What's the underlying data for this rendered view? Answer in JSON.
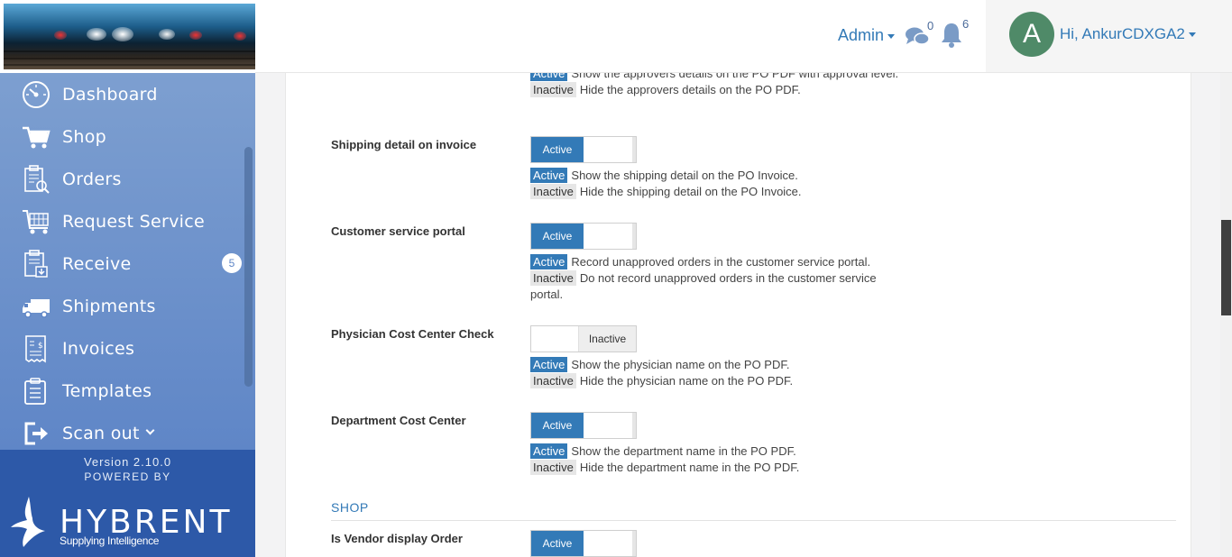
{
  "header": {
    "admin_label": "Admin",
    "messages_count": "0",
    "notifications_count": "6",
    "avatar_initial": "A",
    "user_greeting": "Hi, AnkurCDXGA2"
  },
  "sidebar": {
    "items": [
      {
        "label": "Dashboard",
        "icon": "dashboard-gauge-icon"
      },
      {
        "label": "Shop",
        "icon": "shopping-cart-icon"
      },
      {
        "label": "Orders",
        "icon": "orders-clipboard-search-icon"
      },
      {
        "label": "Request Service",
        "icon": "service-cart-icon"
      },
      {
        "label": "Receive",
        "icon": "receive-clipboard-icon",
        "badge": "5"
      },
      {
        "label": "Shipments",
        "icon": "delivery-truck-icon"
      },
      {
        "label": "Invoices",
        "icon": "invoice-receipt-icon"
      },
      {
        "label": "Templates",
        "icon": "templates-clipboard-icon"
      },
      {
        "label": "Scan out",
        "icon": "scan-out-exit-icon"
      }
    ],
    "version": "Version 2.10.0",
    "powered_by": "POWERED BY",
    "brand_name": "HYBRENT",
    "brand_tagline": "Supplying Intelligence"
  },
  "settings": {
    "partial_top": {
      "active_tag": "Active",
      "active_text": "Show the approvers details on the PO PDF with approval level.",
      "inactive_tag": "Inactive",
      "inactive_text": "Hide the approvers details on the PO PDF."
    },
    "items": [
      {
        "label": "Shipping detail on invoice",
        "state": "Active",
        "active_tag": "Active",
        "active_text": "Show the shipping detail on the PO Invoice.",
        "inactive_tag": "Inactive",
        "inactive_text": "Hide the shipping detail on the PO Invoice."
      },
      {
        "label": "Customer service portal",
        "state": "Active",
        "active_tag": "Active",
        "active_text": "Record unapproved orders in the customer service portal.",
        "inactive_tag": "Inactive",
        "inactive_text": "Do not record unapproved orders in the customer service portal."
      },
      {
        "label": "Physician Cost Center Check",
        "state": "Inactive",
        "active_tag": "Active",
        "active_text": "Show the physician name on the PO PDF.",
        "inactive_tag": "Inactive",
        "inactive_text": "Hide the physician name on the PO PDF."
      },
      {
        "label": "Department Cost Center",
        "state": "Active",
        "active_tag": "Active",
        "active_text": "Show the department name in the PO PDF.",
        "inactive_tag": "Inactive",
        "inactive_text": "Hide the department name in the PO PDF."
      }
    ],
    "shop_section_title": "SHOP",
    "shop_items": [
      {
        "label": "Is Vendor display Order",
        "state": "Active"
      }
    ]
  },
  "colors": {
    "accent": "#337ab7",
    "sidebar_top": "#7d9fd0",
    "sidebar_bottom": "#5f86c7",
    "footer": "#2d59a8",
    "avatar": "#4f8a68"
  }
}
